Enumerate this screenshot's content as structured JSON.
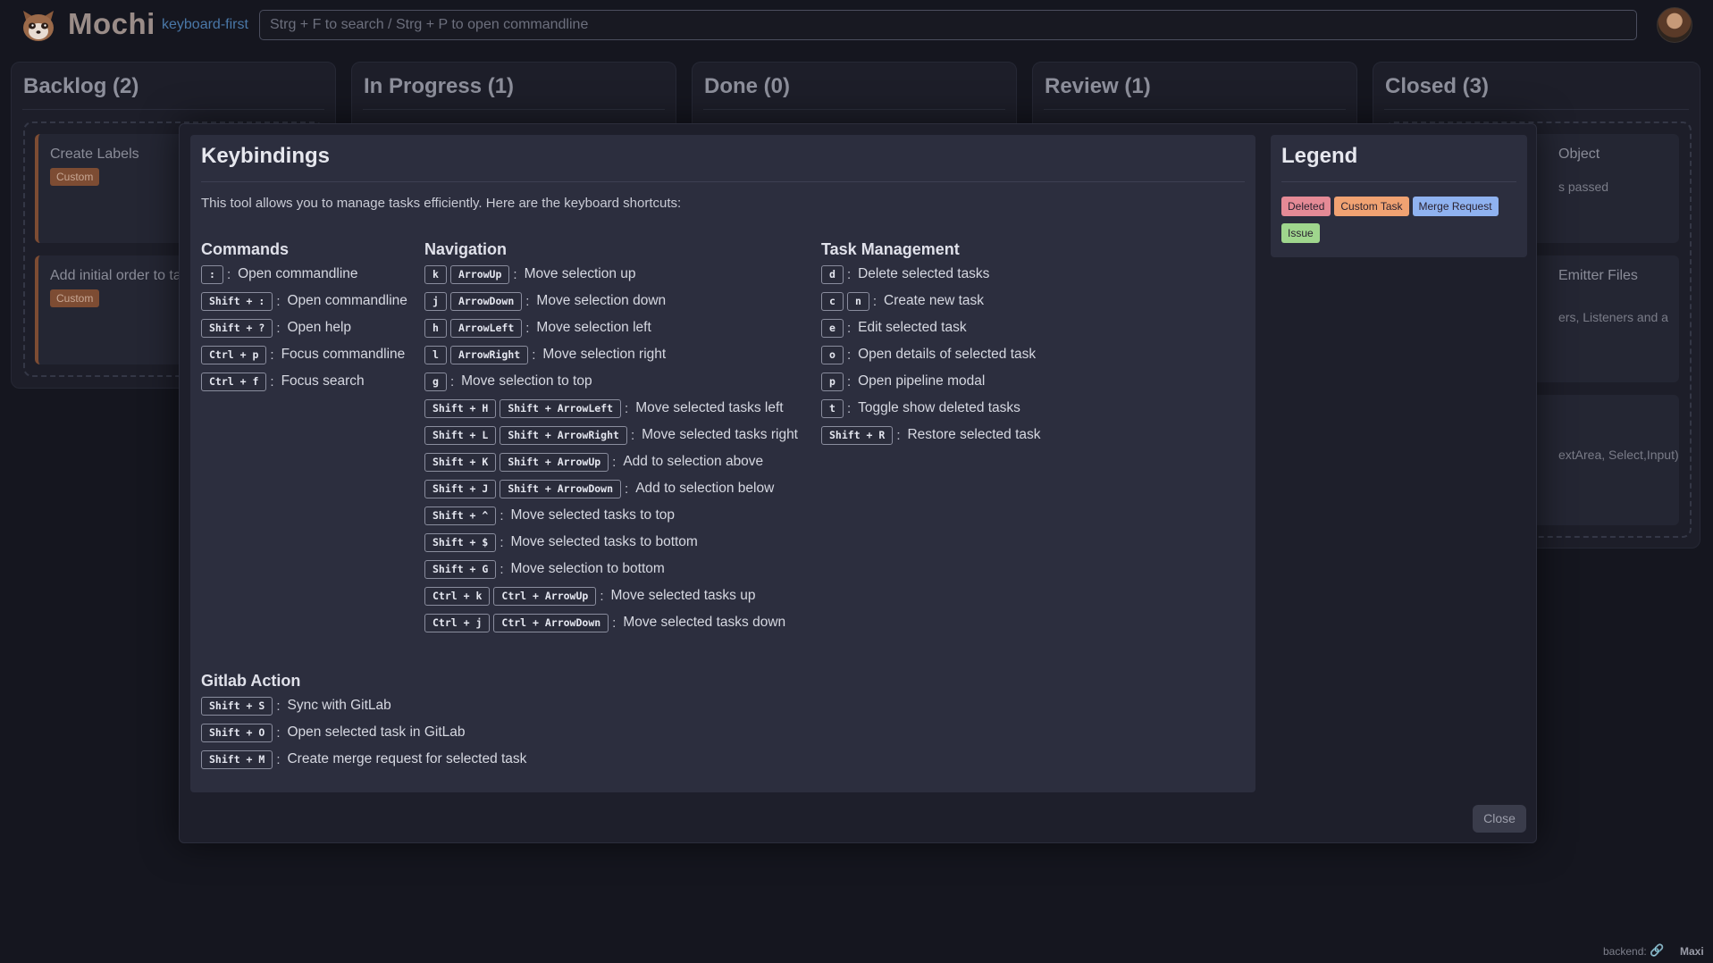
{
  "header": {
    "app_title": "Mochi",
    "app_subtitle": "keyboard-first",
    "search_placeholder": "Strg + F to search / Strg + P to open commandline"
  },
  "columns": [
    {
      "title": "Backlog (2)"
    },
    {
      "title": "In Progress (1)"
    },
    {
      "title": "Done (0)"
    },
    {
      "title": "Review (1)"
    },
    {
      "title": "Closed (3)"
    }
  ],
  "backlog_cards": [
    {
      "title": "Create Labels",
      "badge": "Custom"
    },
    {
      "title": "Add initial order to ta",
      "badge": "Custom"
    }
  ],
  "closed_cards": [
    {
      "title_fragment": "Object",
      "text_fragment": "s passed"
    },
    {
      "title_fragment": "Emitter Files",
      "text_fragment": "ers, Listeners and a"
    },
    {
      "title_fragment": "",
      "text_fragment": "extArea, Select,Input)"
    }
  ],
  "modal": {
    "title": "Keybindings",
    "intro": "This tool allows you to manage tasks efficiently. Here are the keyboard shortcuts:",
    "separator": ":",
    "sections": {
      "commands": {
        "title": "Commands",
        "items": [
          {
            "keys": [
              ":"
            ],
            "desc": "Open commandline"
          },
          {
            "keys": [
              "Shift + :"
            ],
            "desc": "Open commandline"
          },
          {
            "keys": [
              "Shift + ?"
            ],
            "desc": "Open help"
          },
          {
            "keys": [
              "Ctrl + p"
            ],
            "desc": "Focus commandline"
          },
          {
            "keys": [
              "Ctrl + f"
            ],
            "desc": "Focus search"
          }
        ]
      },
      "navigation": {
        "title": "Navigation",
        "items": [
          {
            "keys": [
              "k",
              "ArrowUp"
            ],
            "desc": "Move selection up"
          },
          {
            "keys": [
              "j",
              "ArrowDown"
            ],
            "desc": "Move selection down"
          },
          {
            "keys": [
              "h",
              "ArrowLeft"
            ],
            "desc": "Move selection left"
          },
          {
            "keys": [
              "l",
              "ArrowRight"
            ],
            "desc": "Move selection right"
          },
          {
            "keys": [
              "g"
            ],
            "desc": "Move selection to top"
          },
          {
            "keys": [
              "Shift + H",
              "Shift + ArrowLeft"
            ],
            "desc": "Move selected tasks left"
          },
          {
            "keys": [
              "Shift + L",
              "Shift + ArrowRight"
            ],
            "desc": "Move selected tasks right"
          },
          {
            "keys": [
              "Shift + K",
              "Shift + ArrowUp"
            ],
            "desc": "Add to selection above"
          },
          {
            "keys": [
              "Shift + J",
              "Shift + ArrowDown"
            ],
            "desc": "Add to selection below"
          },
          {
            "keys": [
              "Shift + ^"
            ],
            "desc": "Move selected tasks to top"
          },
          {
            "keys": [
              "Shift + $"
            ],
            "desc": "Move selected tasks to bottom"
          },
          {
            "keys": [
              "Shift + G"
            ],
            "desc": "Move selection to bottom"
          },
          {
            "keys": [
              "Ctrl + k",
              "Ctrl + ArrowUp"
            ],
            "desc": "Move selected tasks up"
          },
          {
            "keys": [
              "Ctrl + j",
              "Ctrl + ArrowDown"
            ],
            "desc": "Move selected tasks down"
          }
        ]
      },
      "task_management": {
        "title": "Task Management",
        "items": [
          {
            "keys": [
              "d"
            ],
            "desc": "Delete selected tasks"
          },
          {
            "keys": [
              "c",
              "n"
            ],
            "desc": "Create new task"
          },
          {
            "keys": [
              "e"
            ],
            "desc": "Edit selected task"
          },
          {
            "keys": [
              "o"
            ],
            "desc": "Open details of selected task"
          },
          {
            "keys": [
              "p"
            ],
            "desc": "Open pipeline modal"
          },
          {
            "keys": [
              "t"
            ],
            "desc": "Toggle show deleted tasks"
          },
          {
            "keys": [
              "Shift + R"
            ],
            "desc": "Restore selected task"
          }
        ]
      },
      "gitlab": {
        "title": "Gitlab Action",
        "items": [
          {
            "keys": [
              "Shift + S"
            ],
            "desc": "Sync with GitLab"
          },
          {
            "keys": [
              "Shift + O"
            ],
            "desc": "Open selected task in GitLab"
          },
          {
            "keys": [
              "Shift + M"
            ],
            "desc": "Create merge request for selected task"
          }
        ]
      }
    },
    "legend": {
      "title": "Legend",
      "badges": [
        {
          "label": "Deleted",
          "color": "#e58a96"
        },
        {
          "label": "Custom Task",
          "color": "#f0a272"
        },
        {
          "label": "Merge Request",
          "color": "#8fb2f0"
        },
        {
          "label": "Issue",
          "color": "#9fd68d"
        }
      ]
    },
    "close_label": "Close"
  },
  "footer": {
    "backend_label": "backend:",
    "link_icon": "link-icon",
    "user": "Maxi"
  },
  "colors": {
    "accent_card": "#7d4c33",
    "background": "#15161f",
    "panel": "#2c2e3e"
  }
}
